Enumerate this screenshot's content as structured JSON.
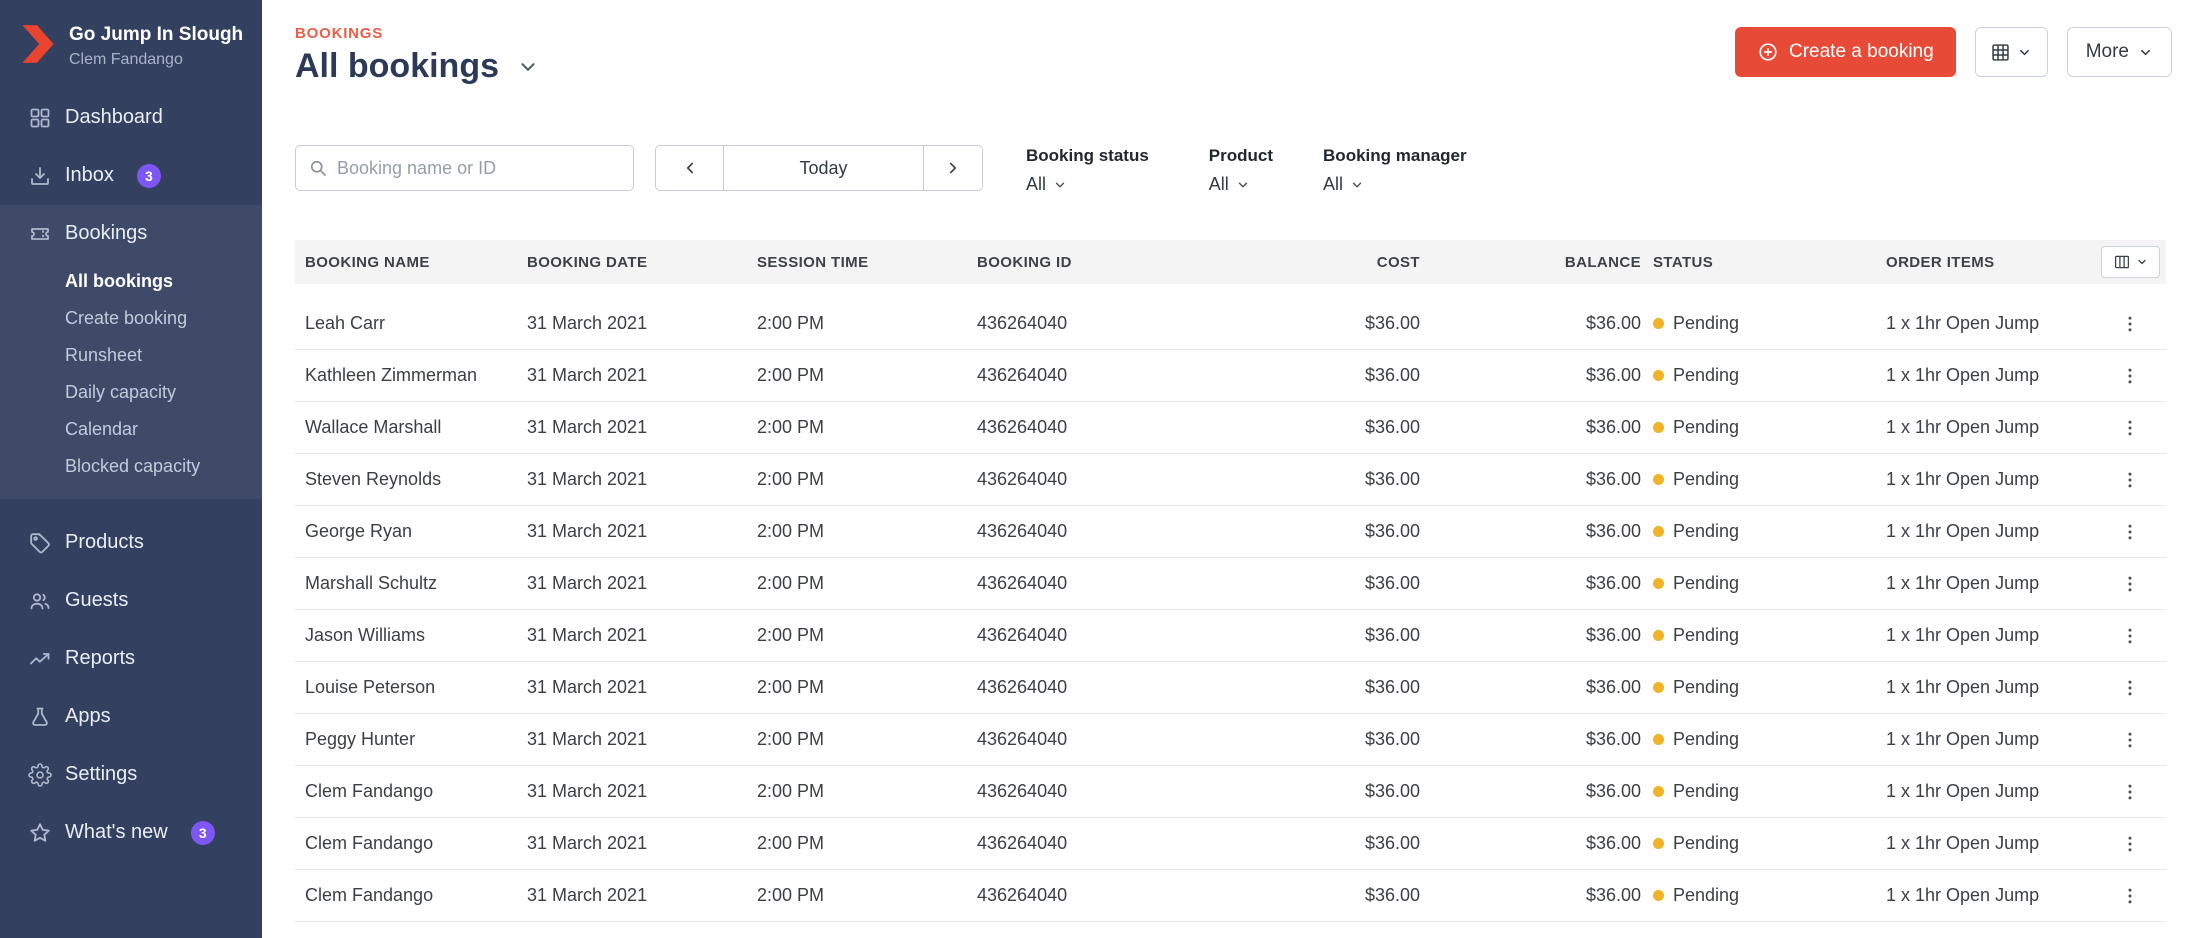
{
  "app": {
    "org_name": "Go Jump In Slough",
    "user_name": "Clem Fandango"
  },
  "sidebar": {
    "items": [
      {
        "label": "Dashboard",
        "icon": "dashboard-icon"
      },
      {
        "label": "Inbox",
        "icon": "inbox-icon",
        "badge": "3"
      },
      {
        "label": "Bookings",
        "icon": "bookings-icon",
        "expanded": true,
        "children": [
          "All bookings",
          "Create booking",
          "Runsheet",
          "Daily capacity",
          "Calendar",
          "Blocked capacity"
        ],
        "selected_child": "All bookings"
      },
      {
        "label": "Products",
        "icon": "products-icon"
      },
      {
        "label": "Guests",
        "icon": "guests-icon"
      },
      {
        "label": "Reports",
        "icon": "reports-icon"
      },
      {
        "label": "Apps",
        "icon": "apps-icon"
      },
      {
        "label": "Settings",
        "icon": "settings-icon"
      },
      {
        "label": "What's new",
        "icon": "whats-new-icon",
        "badge": "3"
      }
    ]
  },
  "header": {
    "eyebrow": "BOOKINGS",
    "title": "All bookings",
    "create_button": "Create a booking",
    "more_button": "More"
  },
  "filters": {
    "search_placeholder": "Booking name or ID",
    "date_nav": {
      "today_label": "Today"
    },
    "dropdowns": [
      {
        "label": "Booking status",
        "value": "All"
      },
      {
        "label": "Product",
        "value": "All"
      },
      {
        "label": "Booking manager",
        "value": "All"
      }
    ]
  },
  "table": {
    "columns": [
      "BOOKING NAME",
      "BOOKING DATE",
      "SESSION TIME",
      "BOOKING ID",
      "COST",
      "BALANCE",
      "STATUS",
      "ORDER ITEMS"
    ],
    "rows": [
      {
        "name": "Leah Carr",
        "date": "31 March 2021",
        "time": "2:00 PM",
        "id": "436264040",
        "cost": "$36.00",
        "balance": "$36.00",
        "status": "Pending",
        "items": "1 x 1hr Open Jump"
      },
      {
        "name": "Kathleen Zimmerman",
        "date": "31 March 2021",
        "time": "2:00 PM",
        "id": "436264040",
        "cost": "$36.00",
        "balance": "$36.00",
        "status": "Pending",
        "items": "1 x 1hr Open Jump"
      },
      {
        "name": "Wallace Marshall",
        "date": "31 March 2021",
        "time": "2:00 PM",
        "id": "436264040",
        "cost": "$36.00",
        "balance": "$36.00",
        "status": "Pending",
        "items": "1 x 1hr Open Jump"
      },
      {
        "name": "Steven Reynolds",
        "date": "31 March 2021",
        "time": "2:00 PM",
        "id": "436264040",
        "cost": "$36.00",
        "balance": "$36.00",
        "status": "Pending",
        "items": "1 x 1hr Open Jump"
      },
      {
        "name": "George Ryan",
        "date": "31 March 2021",
        "time": "2:00 PM",
        "id": "436264040",
        "cost": "$36.00",
        "balance": "$36.00",
        "status": "Pending",
        "items": "1 x 1hr Open Jump"
      },
      {
        "name": "Marshall Schultz",
        "date": "31 March 2021",
        "time": "2:00 PM",
        "id": "436264040",
        "cost": "$36.00",
        "balance": "$36.00",
        "status": "Pending",
        "items": "1 x 1hr Open Jump"
      },
      {
        "name": "Jason Williams",
        "date": "31 March 2021",
        "time": "2:00 PM",
        "id": "436264040",
        "cost": "$36.00",
        "balance": "$36.00",
        "status": "Pending",
        "items": "1 x 1hr Open Jump"
      },
      {
        "name": "Louise Peterson",
        "date": "31 March 2021",
        "time": "2:00 PM",
        "id": "436264040",
        "cost": "$36.00",
        "balance": "$36.00",
        "status": "Pending",
        "items": "1 x 1hr Open Jump"
      },
      {
        "name": "Peggy Hunter",
        "date": "31 March 2021",
        "time": "2:00 PM",
        "id": "436264040",
        "cost": "$36.00",
        "balance": "$36.00",
        "status": "Pending",
        "items": "1 x 1hr Open Jump"
      },
      {
        "name": "Clem Fandango",
        "date": "31 March 2021",
        "time": "2:00 PM",
        "id": "436264040",
        "cost": "$36.00",
        "balance": "$36.00",
        "status": "Pending",
        "items": "1 x 1hr Open Jump"
      },
      {
        "name": "Clem Fandango",
        "date": "31 March 2021",
        "time": "2:00 PM",
        "id": "436264040",
        "cost": "$36.00",
        "balance": "$36.00",
        "status": "Pending",
        "items": "1 x 1hr Open Jump"
      },
      {
        "name": "Clem Fandango",
        "date": "31 March 2021",
        "time": "2:00 PM",
        "id": "436264040",
        "cost": "$36.00",
        "balance": "$36.00",
        "status": "Pending",
        "items": "1 x 1hr Open Jump"
      }
    ]
  },
  "colors": {
    "accent_red": "#e74b37",
    "eyebrow_red": "#e8604a",
    "badge_purple": "#7d56f3",
    "status_pending_yellow": "#f0b429",
    "sidebar_bg": "#334060"
  }
}
